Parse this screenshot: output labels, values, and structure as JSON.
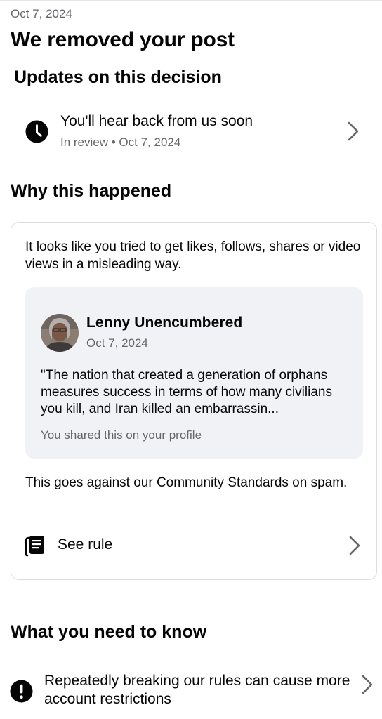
{
  "header": {
    "date": "Oct 7, 2024",
    "title": "We removed your post"
  },
  "updates": {
    "heading": "Updates on this decision",
    "item": {
      "icon": "clock-icon",
      "title": "You'll hear back from us soon",
      "subtitle": "In review • Oct 7, 2024"
    }
  },
  "why": {
    "heading": "Why this happened",
    "reason": "It looks like you tried to get likes, follows, shares or video views in a misleading way.",
    "post": {
      "author": "Lenny Unencumbered",
      "date": "Oct 7, 2024",
      "body": "\"The nation that created a generation of orphans measures success in terms of how many civilians you kill, and Iran killed an embarrassin...",
      "footer": "You shared this on your profile"
    },
    "standards": "This goes against our Community Standards on spam.",
    "see_rule": {
      "icon": "book-icon",
      "label": "See rule"
    }
  },
  "know": {
    "heading": "What you need to know",
    "item": {
      "icon": "warning-icon",
      "text": "Repeatedly breaking our rules can cause more account restrictions"
    }
  },
  "colors": {
    "text_primary": "#050505",
    "text_secondary": "#65676b",
    "card_bg": "#f0f2f5",
    "border": "#dadde1"
  }
}
